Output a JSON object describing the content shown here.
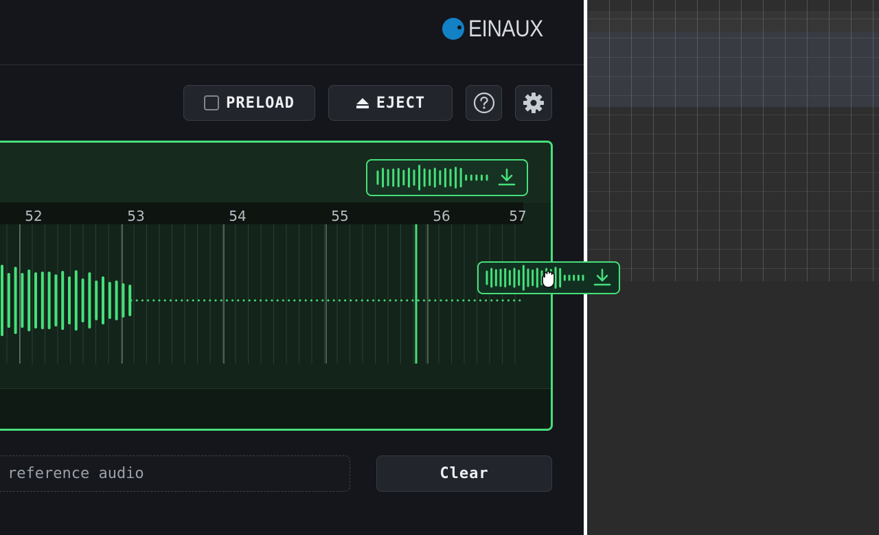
{
  "brand": {
    "name": "EINAUX",
    "color": "#1381c6"
  },
  "toolbar": {
    "preload_label": "PRELOAD",
    "preload_checked": false,
    "eject_label": "EJECT",
    "help_icon": "help-circle-icon",
    "settings_icon": "gear-icon"
  },
  "timeline": {
    "ticks": [
      "52",
      "53",
      "54",
      "55",
      "56",
      "57"
    ],
    "accent": "#46e07a"
  },
  "reference": {
    "placeholder": "reference audio"
  },
  "actions": {
    "clear_label": "Clear"
  }
}
